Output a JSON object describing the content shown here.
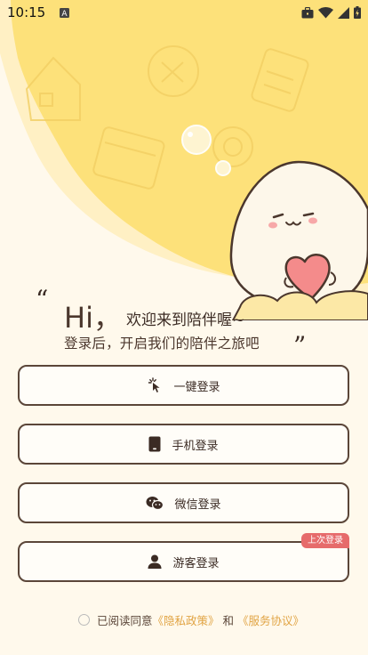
{
  "status_bar": {
    "time": "10:15",
    "notification_icon": "a-square-icon",
    "icons": [
      "briefcase-icon",
      "wifi-icon",
      "signal-icon",
      "battery-icon"
    ]
  },
  "greeting": {
    "quote_open": "“",
    "hi": "Hi，",
    "welcome": "欢迎来到陪伴喔~",
    "subtitle": "登录后，开启我们的陪伴之旅吧",
    "quote_close": "”"
  },
  "buttons": {
    "one_click": {
      "label": "一键登录",
      "icon": "tap-icon"
    },
    "phone": {
      "label": "手机登录",
      "icon": "phone-icon"
    },
    "wechat": {
      "label": "微信登录",
      "icon": "wechat-icon"
    },
    "guest": {
      "label": "游客登录",
      "icon": "person-icon",
      "badge": "上次登录"
    }
  },
  "agreement": {
    "prefix": "已阅读同意",
    "privacy": "《隐私政策》",
    "and": "和",
    "service": "《服务协议》"
  },
  "colors": {
    "background": "#fff9ec",
    "hero_yellow": "#fde17a",
    "text_brown": "#5b4639",
    "link": "#e1a444",
    "badge": "#e66b6b"
  }
}
